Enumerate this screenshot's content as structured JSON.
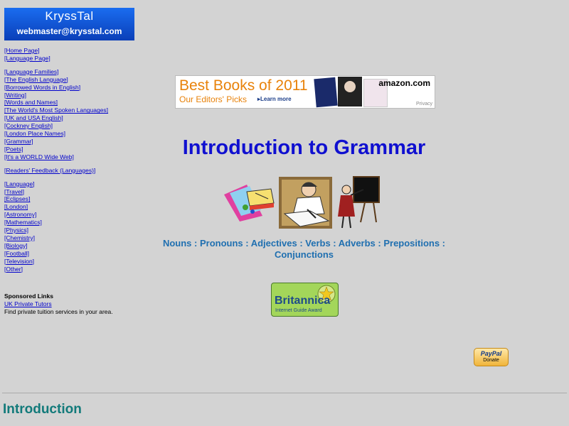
{
  "logo": {
    "name": "KryssTal",
    "email": "webmaster@krysstal.com"
  },
  "nav": {
    "group1": [
      "[Home Page]",
      "[Language Page]"
    ],
    "group2": [
      "[Language Families]",
      "[The English Language]",
      "[Borrowed Words in English]",
      "[Writing]",
      "[Words and Names]",
      "[The World's Most Spoken Languages]",
      "[UK and USA English]",
      "[Cockney English]",
      "[London Place Names]",
      "[Grammar]",
      "[Poets]",
      "[It's a WORLD Wide Web]"
    ],
    "group3": [
      "[Readers' Feedback (Languages)]"
    ],
    "group4": [
      "[Language]",
      "[Travel]",
      "[Eclipses]",
      "[London]",
      "[Astronomy]",
      "[Mathematics]",
      "[Physics]",
      "[Chemistry]",
      "[Biology]",
      "[Football]",
      "[Television]",
      "[Other]"
    ]
  },
  "sponsored": {
    "heading": "Sponsored Links",
    "link": "UK Private Tutors",
    "desc": "Find private tuition services in your area."
  },
  "ad": {
    "headline": "Best Books of 2011",
    "subline": "Our Editors' Picks",
    "learn": "▸Learn more",
    "brand": "amazon.com",
    "privacy": "Privacy"
  },
  "page": {
    "title": "Introduction to Grammar",
    "parts_of_speech": "Nouns : Pronouns : Adjectives : Verbs : Adverbs : Prepositions : Conjunctions",
    "section_heading": "Introduction"
  },
  "britannica": {
    "name": "Britannica",
    "sub": "Internet Guide Award"
  },
  "paypal": {
    "brand": "PayPal",
    "label": "Donate"
  }
}
